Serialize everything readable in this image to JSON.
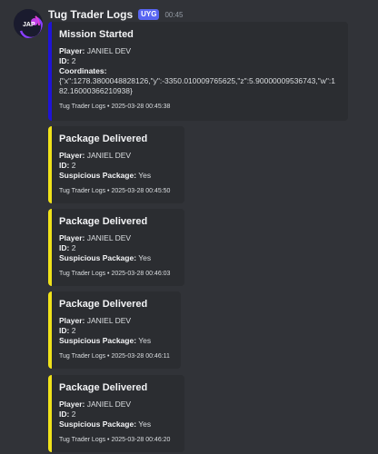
{
  "message": {
    "username": "Tug Trader Logs",
    "app_badge": "UYG",
    "timestamp": "00:45"
  },
  "embeds": [
    {
      "title": "Mission Started",
      "color": "#1f14d6",
      "fields": [
        {
          "label": "Player:",
          "value": "JANIEL DEV"
        },
        {
          "label": "ID:",
          "value": "2"
        },
        {
          "label": "Coordinates:",
          "value": "{\"x\":1278.3800048828126,\"y\":-3350.010009765625,\"z\":5.90000009536743,\"w\":182.16000366210938}"
        }
      ],
      "footer": "Tug Trader Logs • 2025-03-28 00:45:38"
    },
    {
      "title": "Package Delivered",
      "color": "#f0e21a",
      "fields": [
        {
          "label": "Player:",
          "value": "JANIEL DEV"
        },
        {
          "label": "ID:",
          "value": "2"
        },
        {
          "label": "Suspicious Package:",
          "value": "Yes"
        }
      ],
      "footer": "Tug Trader Logs • 2025-03-28 00:45:50"
    },
    {
      "title": "Package Delivered",
      "color": "#f0e21a",
      "fields": [
        {
          "label": "Player:",
          "value": "JANIEL DEV"
        },
        {
          "label": "ID:",
          "value": "2"
        },
        {
          "label": "Suspicious Package:",
          "value": "Yes"
        }
      ],
      "footer": "Tug Trader Logs • 2025-03-28 00:46:03"
    },
    {
      "title": "Package Delivered",
      "color": "#f0e21a",
      "fields": [
        {
          "label": "Player:",
          "value": "JANIEL DEV"
        },
        {
          "label": "ID:",
          "value": "2"
        },
        {
          "label": "Suspicious Package:",
          "value": "Yes"
        }
      ],
      "footer": "Tug Trader Logs • 2025-03-28 00:46:11"
    },
    {
      "title": "Package Delivered",
      "color": "#f0e21a",
      "fields": [
        {
          "label": "Player:",
          "value": "JANIEL DEV"
        },
        {
          "label": "ID:",
          "value": "2"
        },
        {
          "label": "Suspicious Package:",
          "value": "Yes"
        }
      ],
      "footer": "Tug Trader Logs • 2025-03-28 00:46:20"
    }
  ]
}
